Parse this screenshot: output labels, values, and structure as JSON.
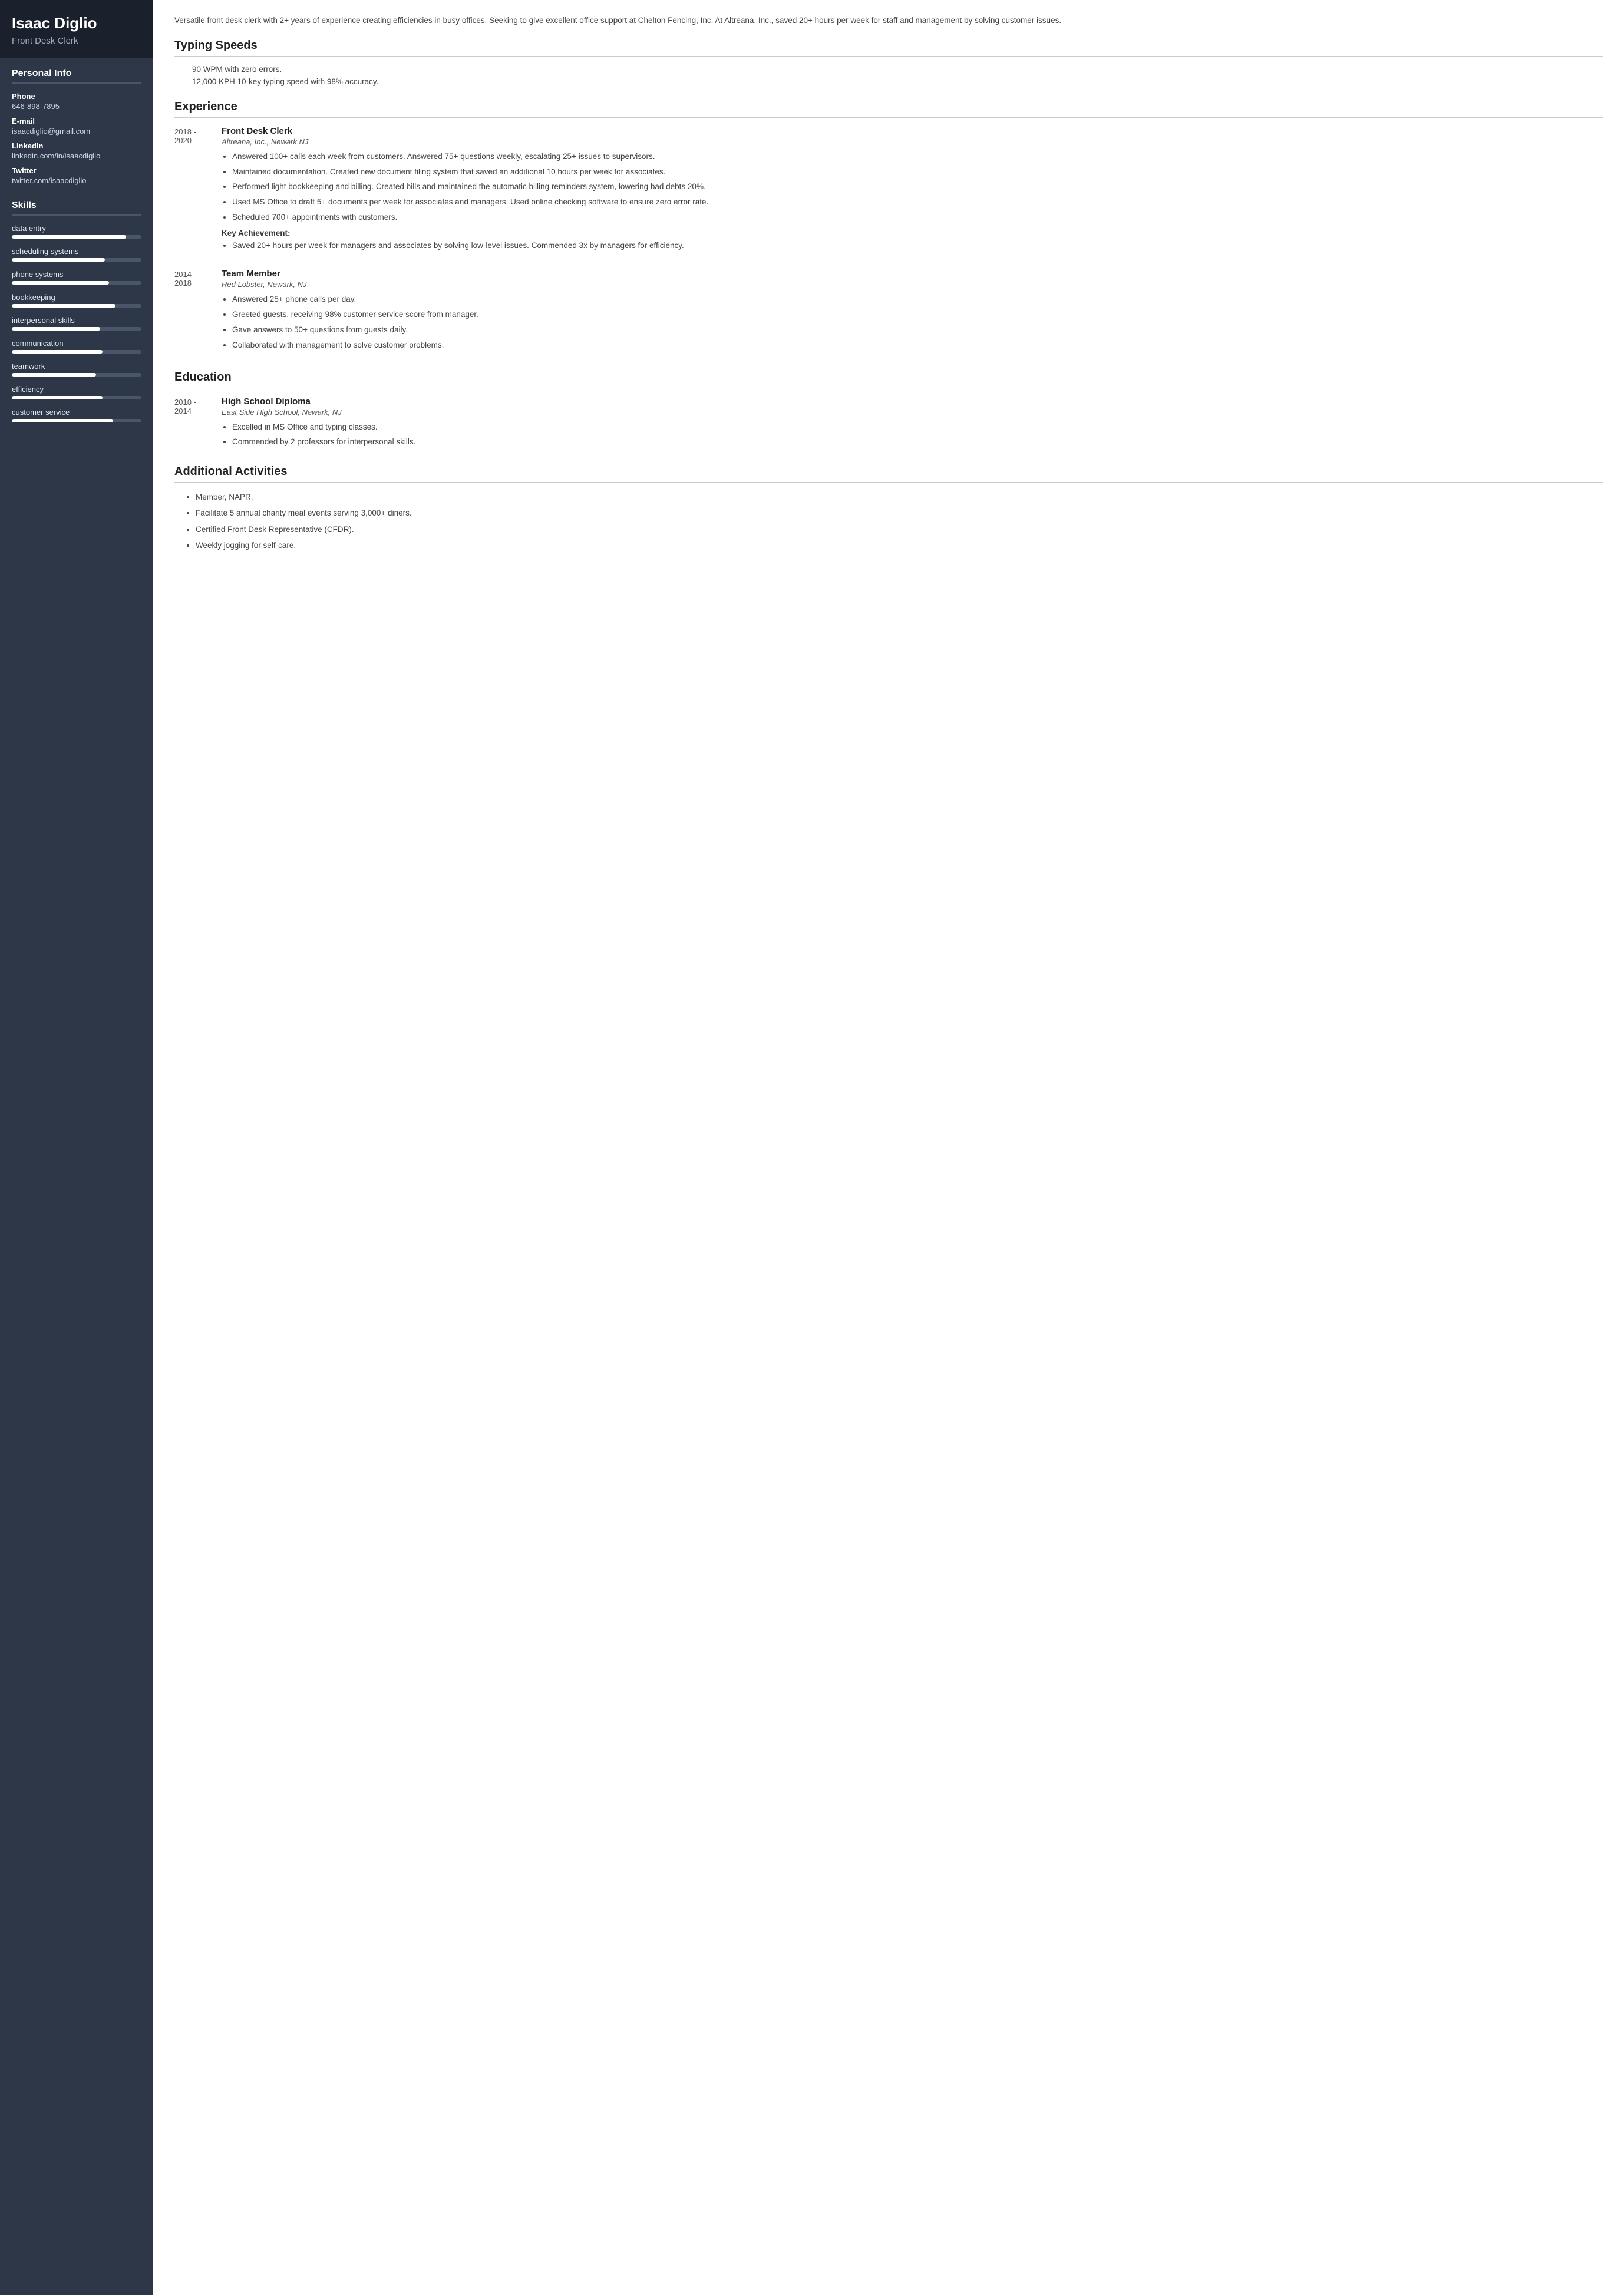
{
  "sidebar": {
    "name": "Isaac Diglio",
    "title": "Front Desk Clerk",
    "personal_info_label": "Personal Info",
    "phone_label": "Phone",
    "phone_value": "646-898-7895",
    "email_label": "E-mail",
    "email_value": "isaacdiglio@gmail.com",
    "linkedin_label": "LinkedIn",
    "linkedin_value": "linkedin.com/in/isaacdiglio",
    "twitter_label": "Twitter",
    "twitter_value": "twitter.com/isaacdiglio",
    "skills_label": "Skills",
    "skills": [
      {
        "name": "data entry",
        "percent": 88
      },
      {
        "name": "scheduling systems",
        "percent": 72
      },
      {
        "name": "phone systems",
        "percent": 75
      },
      {
        "name": "bookkeeping",
        "percent": 80
      },
      {
        "name": "interpersonal skills",
        "percent": 68
      },
      {
        "name": "communication",
        "percent": 70
      },
      {
        "name": "teamwork",
        "percent": 65
      },
      {
        "name": "efficiency",
        "percent": 70
      },
      {
        "name": "customer service",
        "percent": 78
      }
    ]
  },
  "main": {
    "summary": "Versatile front desk clerk with 2+ years of experience creating efficiencies in busy offices. Seeking to give excellent office support at Chelton Fencing, Inc. At Altreana, Inc., saved 20+ hours per week for staff and management by solving customer issues.",
    "typing_speeds_label": "Typing Speeds",
    "typing_speeds": [
      "90 WPM with zero errors.",
      "12,000 KPH 10-key typing speed with 98% accuracy."
    ],
    "experience_label": "Experience",
    "experience": [
      {
        "start": "2018 -",
        "end": "2020",
        "title": "Front Desk Clerk",
        "company": "Altreana, Inc., Newark NJ",
        "bullets": [
          "Answered 100+ calls each week from customers. Answered 75+ questions weekly, escalating 25+ issues to supervisors.",
          "Maintained documentation. Created new document filing system that saved an additional 10 hours per week for associates.",
          "Performed light bookkeeping and billing. Created bills and maintained the automatic billing reminders system, lowering bad debts 20%.",
          "Used MS Office to draft 5+ documents per week for associates and managers. Used online checking software to ensure zero error rate.",
          "Scheduled 700+ appointments with customers."
        ],
        "key_achievement_label": "Key Achievement:",
        "key_achievement_bullets": [
          "Saved 20+ hours per week for managers and associates by solving low-level issues. Commended 3x by managers for efficiency."
        ]
      },
      {
        "start": "2014 -",
        "end": "2018",
        "title": "Team Member",
        "company": "Red Lobster, Newark, NJ",
        "bullets": [
          "Answered 25+ phone calls per day.",
          "Greeted guests, receiving 98% customer service score from manager.",
          "Gave answers to 50+ questions from guests daily.",
          "Collaborated with management to solve customer problems."
        ],
        "key_achievement_label": null,
        "key_achievement_bullets": []
      }
    ],
    "education_label": "Education",
    "education": [
      {
        "start": "2010 -",
        "end": "2014",
        "degree": "High School Diploma",
        "school": "East Side High School, Newark, NJ",
        "bullets": [
          "Excelled in MS Office and typing classes.",
          "Commended by 2 professors for interpersonal skills."
        ]
      }
    ],
    "activities_label": "Additional Activities",
    "activities": [
      "Member, NAPR.",
      "Facilitate 5 annual charity meal events serving 3,000+ diners.",
      "Certified Front Desk Representative (CFDR).",
      "Weekly jogging for self-care."
    ]
  }
}
